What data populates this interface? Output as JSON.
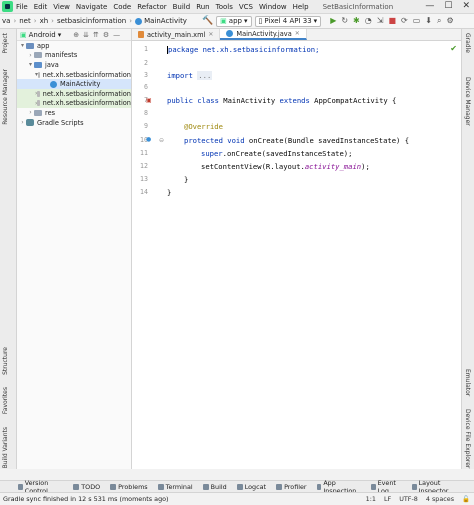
{
  "titlebar": {
    "menu": [
      "File",
      "Edit",
      "View",
      "Navigate",
      "Code",
      "Refactor",
      "Build",
      "Run",
      "Tools",
      "VCS",
      "Window",
      "Help"
    ],
    "title": "SetBasicInformation",
    "min": "—",
    "max": "☐",
    "close": "✕"
  },
  "navbar": {
    "crumbs": [
      "va",
      "net",
      "xh",
      "setbasicinformation",
      "MainActivity"
    ],
    "module": "app",
    "device": "Pixel 4 API 33"
  },
  "project": {
    "view": "Android",
    "tree": [
      {
        "label": "app",
        "indent": 0,
        "arrow": "▾",
        "icon": "module"
      },
      {
        "label": "manifests",
        "indent": 1,
        "arrow": "›",
        "icon": "folder"
      },
      {
        "label": "java",
        "indent": 1,
        "arrow": "▾",
        "icon": "folder-blue"
      },
      {
        "label": "net.xh.setbasicinformation",
        "indent": 2,
        "arrow": "▾",
        "icon": "package"
      },
      {
        "label": "MainActivity",
        "indent": 3,
        "arrow": "",
        "icon": "class",
        "selected": true
      },
      {
        "label": "net.xh.setbasicinformation",
        "indent": 2,
        "arrow": "›",
        "icon": "package",
        "green": true
      },
      {
        "label": "net.xh.setbasicinformation",
        "indent": 2,
        "arrow": "›",
        "icon": "package",
        "green": true
      },
      {
        "label": "res",
        "indent": 1,
        "arrow": "›",
        "icon": "folder"
      },
      {
        "label": "Gradle Scripts",
        "indent": 0,
        "arrow": "›",
        "icon": "gradle"
      }
    ]
  },
  "left_tabs": {
    "project": "Project",
    "resource_manager": "Resource Manager",
    "structure": "Structure",
    "favorites": "Favorites",
    "build_variants": "Build Variants"
  },
  "right_tabs": {
    "gradle": "Gradle",
    "device_manager": "Device Manager",
    "emulator": "Emulator",
    "device_file_explorer": "Device File Explorer"
  },
  "editor": {
    "tabs": [
      {
        "label": "activity_main.xml",
        "icon": "xml"
      },
      {
        "label": "MainActivity.java",
        "icon": "class",
        "active": true
      }
    ],
    "line_numbers": [
      "1",
      "2",
      "3",
      "6",
      "7",
      "8",
      "9",
      "10",
      "11",
      "12",
      "13",
      "14"
    ],
    "code": {
      "l1": "package net.xh.setbasicinformation;",
      "l2_kw": "import",
      "l2_fold": "...",
      "l3_a": "public class ",
      "l3_b": "MainActivity ",
      "l3_c": "extends ",
      "l3_d": "AppCompatActivity {",
      "l4": "@Override",
      "l5_a": "protected void ",
      "l5_b": "onCreate(Bundle savedInstanceState) {",
      "l6_a": "super",
      "l6_b": ".onCreate(savedInstanceState);",
      "l7_a": "setContentView(R.layout.",
      "l7_b": "activity_main",
      "l7_c": ");",
      "l8": "}",
      "l9": "}"
    }
  },
  "bottom_tools": {
    "left": [
      "Version Control",
      "TODO",
      "Problems",
      "Terminal",
      "Build",
      "Logcat",
      "Profiler",
      "App Inspection"
    ],
    "right": [
      "Event Log",
      "Layout Inspector"
    ]
  },
  "status": {
    "message": "Gradle sync finished in 12 s 531 ms (moments ago)",
    "position": "1:1",
    "line_sep": "LF",
    "encoding": "UTF-8",
    "indent": "4 spaces"
  }
}
